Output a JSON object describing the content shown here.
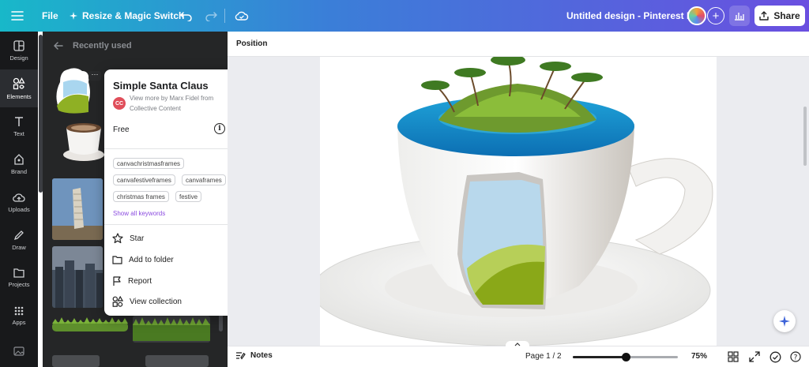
{
  "topbar": {
    "file_label": "File",
    "resize_label": "Resize & Magic Switch",
    "title": "Untitled design - Pinterest Pin",
    "share_label": "Share"
  },
  "rail": {
    "items": [
      {
        "label": "Design",
        "icon": "design-icon"
      },
      {
        "label": "Elements",
        "icon": "elements-icon"
      },
      {
        "label": "Text",
        "icon": "text-icon"
      },
      {
        "label": "Brand",
        "icon": "brand-icon"
      },
      {
        "label": "Uploads",
        "icon": "uploads-icon"
      },
      {
        "label": "Draw",
        "icon": "draw-icon"
      },
      {
        "label": "Projects",
        "icon": "projects-icon"
      },
      {
        "label": "Apps",
        "icon": "apps-icon"
      }
    ],
    "active": "Elements"
  },
  "panel": {
    "heading": "Recently used"
  },
  "popup": {
    "title": "Simple Santa Claus",
    "avatar_initials": "CC",
    "byline": "View more by Marx Fidel from Collective Content",
    "price": "Free",
    "tags": [
      "canvachristmasframes",
      "canvafestiveframes",
      "canvaframes",
      "christmas frames",
      "festive"
    ],
    "show_all": "Show all keywords",
    "menu": [
      {
        "label": "Star",
        "icon": "star-icon"
      },
      {
        "label": "Add to folder",
        "icon": "folder-icon"
      },
      {
        "label": "Report",
        "icon": "flag-icon"
      },
      {
        "label": "View collection",
        "icon": "collection-icon"
      }
    ]
  },
  "editor": {
    "toolbar_label": "Position"
  },
  "bottom": {
    "notes_label": "Notes",
    "page_indicator": "Page 1 / 2",
    "zoom": "75%",
    "zoom_fraction": 0.5
  },
  "colors": {
    "accent_purple": "#8c4de0",
    "topbar_start": "#18b8c9",
    "topbar_end": "#6a4fe0",
    "rail_bg": "#18191b",
    "panel_bg": "#252627"
  }
}
